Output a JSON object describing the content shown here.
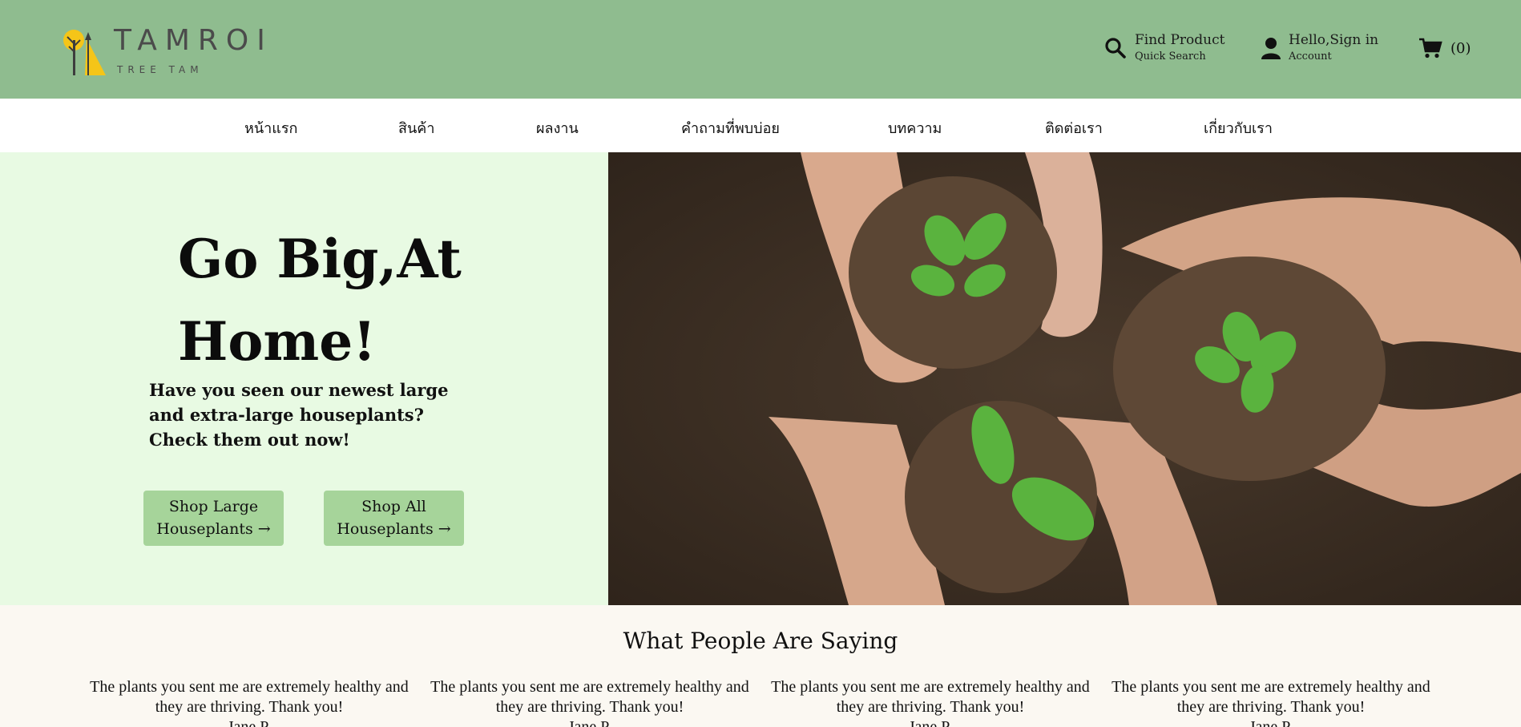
{
  "header": {
    "logo": {
      "brand": "TAMROI",
      "subtitle": "TREE TAM"
    },
    "find": {
      "title": "Find Product",
      "subtitle": "Quick Search",
      "icon": "search-icon"
    },
    "account": {
      "title": "Hello,Sign in",
      "subtitle": "Account",
      "icon": "user-icon"
    },
    "cart": {
      "count": "(0)",
      "icon": "cart-icon"
    }
  },
  "nav": {
    "items": [
      "หน้าแรก",
      "สินค้า",
      "ผลงาน",
      "คำถามที่พบบ่อย",
      "บทความ",
      "ติดต่อเรา",
      "เกี่ยวกับเรา"
    ]
  },
  "hero": {
    "title": "Go Big,At Home!",
    "description": "Have you seen our newest large and extra-large houseplants? Check them out now!",
    "buttons": {
      "large": "Shop Large Houseplants →",
      "all": "Shop All Houseplants →"
    }
  },
  "testimonials": {
    "title": "What People Are Saying",
    "items": [
      {
        "quote": "The plants you sent me are extremely healthy and they are thriving. Thank you!",
        "author": "Jane P."
      },
      {
        "quote": "The plants you sent me are extremely healthy and they are thriving. Thank you!",
        "author": "Jane P."
      },
      {
        "quote": "The plants you sent me are extremely healthy and they are thriving. Thank you!",
        "author": "Jane P."
      },
      {
        "quote": "The plants you sent me are extremely healthy and they are thriving. Thank you!",
        "author": "Jane P."
      }
    ]
  },
  "colors": {
    "header_bg": "#8fbc8f",
    "hero_bg": "#e8fae3",
    "button_bg": "#a6d49a",
    "logo_yellow": "#f5c518"
  }
}
